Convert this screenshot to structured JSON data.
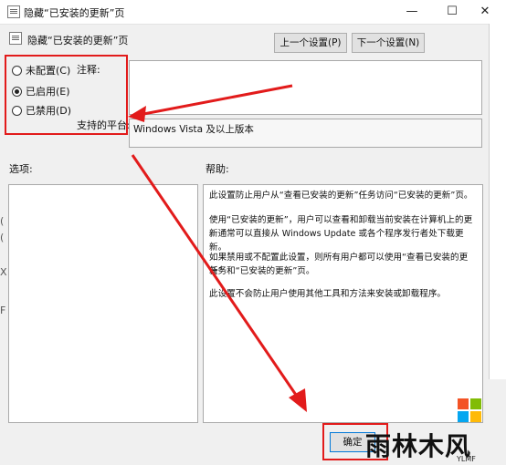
{
  "window": {
    "title": "隐藏“已安装的更新”页",
    "minimize_glyph": "—",
    "maximize_glyph": "☐",
    "close_glyph": "✕"
  },
  "header": {
    "policy_name": "隐藏“已安装的更新”页",
    "prev_button": "上一个设置(P)",
    "next_button": "下一个设置(N)"
  },
  "options": [
    {
      "label": "未配置(C)",
      "checked": false
    },
    {
      "label": "已启用(E)",
      "checked": true
    },
    {
      "label": "已禁用(D)",
      "checked": false
    }
  ],
  "comment": {
    "label": "注释:",
    "value": ""
  },
  "platform": {
    "label": "支持的平台:",
    "value": "Windows Vista 及以上版本"
  },
  "sections": {
    "options_label": "选项:",
    "help_label": "帮助:"
  },
  "help": [
    "此设置防止用户从“查看已安装的更新”任务访问“已安装的更新”页。",
    "使用“已安装的更新”，用户可以查看和卸载当前安装在计算机上的更新",
    "。通常可以直接从 Windows Update 或各个程序发行者处下载更新。",
    "如果禁用或不配置此设置，则所有用户都可以使用“查看已安装的更新”",
    "任务和“已安装的更新”页。",
    "此设置不会防止用户使用其他工具和方法来安装或卸载程序。"
  ],
  "footer": {
    "ok_button": "确定"
  },
  "left_edge_glyphs": [
    "(",
    "(",
    "X",
    "F"
  ],
  "watermark": {
    "text": "雨林木风",
    "sub": "YLMF"
  },
  "colors": {
    "annotation_red": "#e21b1b",
    "dialog_bg": "#f0f0f0"
  },
  "icons": {
    "policy": "policy-settings-icon"
  }
}
